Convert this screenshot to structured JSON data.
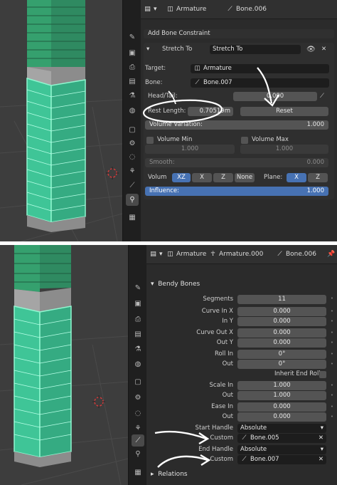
{
  "top": {
    "header": {
      "object": "Armature",
      "bone": "Bone.006"
    },
    "add_constraint": "Add Bone Constraint",
    "constraint": {
      "type": "Stretch To",
      "name": "Stretch To"
    },
    "target": {
      "label": "Target:",
      "value": "Armature"
    },
    "bone": {
      "label": "Bone:",
      "value": "Bone.007"
    },
    "head_tail": {
      "label": "Head/Tail:",
      "value": "0.000"
    },
    "rest_length": {
      "label": "Rest Length:",
      "value": "0.70519m"
    },
    "reset_label": "Reset",
    "volume_variation": {
      "label": "Volume Variation:",
      "value": "1.000"
    },
    "volume_min": {
      "label": "Volume Min",
      "value": "1.000"
    },
    "volume_max": {
      "label": "Volume Max",
      "value": "1.000"
    },
    "smooth": {
      "label": "Smooth:",
      "value": "0.000"
    },
    "volume_axis": {
      "label": "Volum",
      "options": [
        "XZ",
        "X",
        "Z",
        "None"
      ],
      "selected": "XZ"
    },
    "plane": {
      "label": "Plane:",
      "options": [
        "X",
        "Z"
      ],
      "selected": "X"
    },
    "influence": {
      "label": "Influence:",
      "value": "1.000"
    }
  },
  "bottom": {
    "header": {
      "object": "Armature",
      "armature": "Armature.000",
      "bone": "Bone.006"
    },
    "panel": "Bendy Bones",
    "segments": {
      "label": "Segments",
      "value": "11"
    },
    "curve_in_x": {
      "label": "Curve In X",
      "value": "0.000"
    },
    "curve_in_y": {
      "label": "In Y",
      "value": "0.000"
    },
    "curve_out_x": {
      "label": "Curve Out X",
      "value": "0.000"
    },
    "curve_out_y": {
      "label": "Out Y",
      "value": "0.000"
    },
    "roll_in": {
      "label": "Roll In",
      "value": "0°"
    },
    "roll_out": {
      "label": "Out",
      "value": "0°"
    },
    "inherit_end_roll": "Inherit End Roll",
    "scale_in": {
      "label": "Scale In",
      "value": "1.000"
    },
    "scale_out": {
      "label": "Out",
      "value": "1.000"
    },
    "ease_in": {
      "label": "Ease In",
      "value": "0.000"
    },
    "ease_out": {
      "label": "Out",
      "value": "0.000"
    },
    "start_handle": {
      "label": "Start Handle",
      "value": "Absolute"
    },
    "start_custom": {
      "label": "Custom",
      "value": "Bone.005"
    },
    "end_handle": {
      "label": "End Handle",
      "value": "Absolute"
    },
    "end_custom": {
      "label": "Custom",
      "value": "Bone.007"
    },
    "relations": "Relations"
  },
  "colors": {
    "panel_bg": "#2b2b2b",
    "field": "#545454",
    "accent_blue": "#4772b3",
    "mesh_green": "#3fc597",
    "annotation": "#ffffff"
  },
  "icons": [
    "properties-editor-icon",
    "armature-icon",
    "bone-icon",
    "pin-icon",
    "eye-icon",
    "wrench-icon",
    "constraint-icon"
  ]
}
